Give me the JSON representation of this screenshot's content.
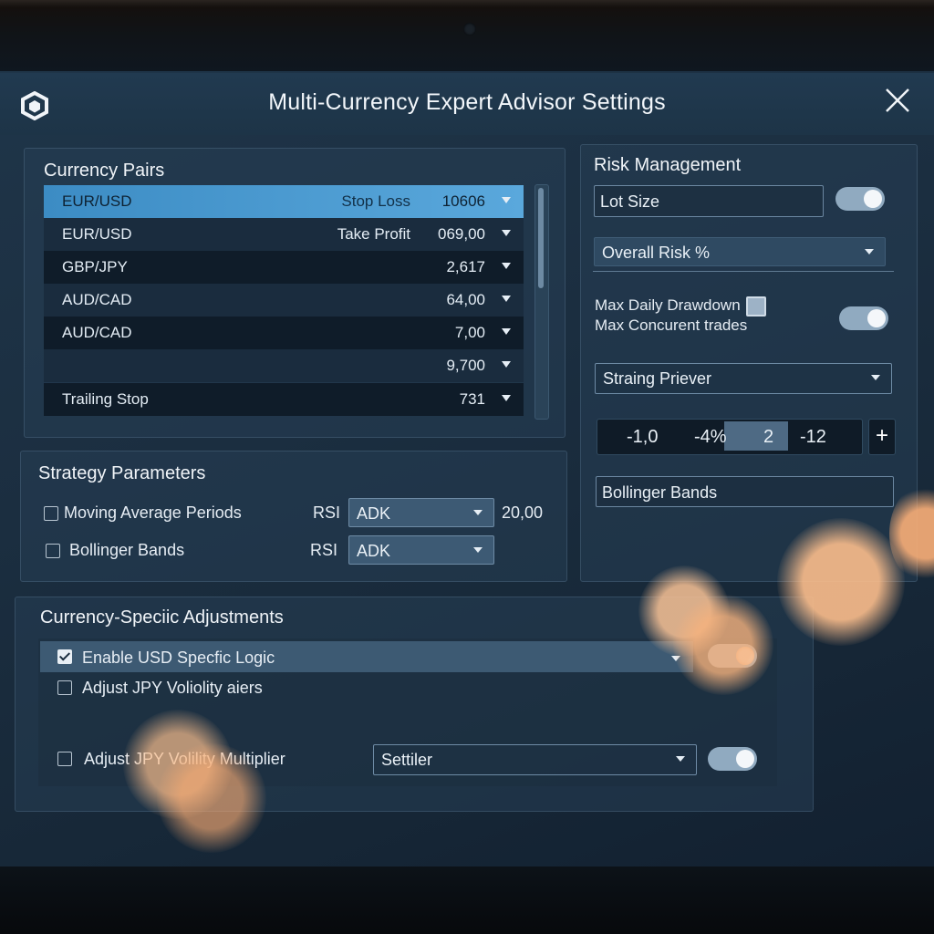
{
  "window": {
    "title": "Multi-Currency Expert Advisor Settings",
    "logo_icon": "cube-logo-icon",
    "close_icon": "close-x-icon"
  },
  "currency_pairs": {
    "title": "Currency Pairs",
    "rows": [
      {
        "name": "EUR/USD",
        "label": "Stop Loss",
        "value": "10606",
        "selected": true
      },
      {
        "name": "EUR/USD",
        "label": "Take Profit",
        "value": "069,00"
      },
      {
        "name": "GBP/JPY",
        "label": "",
        "value": "2,617"
      },
      {
        "name": "AUD/CAD",
        "label": "",
        "value": "64,00"
      },
      {
        "name": "AUD/CAD",
        "label": "",
        "value": "7,00"
      },
      {
        "name": "",
        "label": "",
        "value": "9,700"
      },
      {
        "name": "Trailing Stop",
        "label": "",
        "value": "731"
      }
    ]
  },
  "strategy": {
    "title": "Strategy Parameters",
    "rows": [
      {
        "label": "Moving Average Periods",
        "indicator": "RSI",
        "select": "ADK",
        "value": "20,00"
      },
      {
        "label": "Bollinger Bands",
        "indicator": "RSI",
        "select": "ADK"
      }
    ]
  },
  "risk": {
    "title": "Risk Management",
    "lot_size_placeholder": "Lot Size",
    "overall_risk": "Overall Risk %",
    "max_daily_drawdown": "Max Daily Drawdown",
    "max_concurrent_trades": "Max Concurent trades",
    "strategy_select": "Straing Priever",
    "stepper": [
      "-1,0",
      "-4%",
      "2",
      "-12"
    ],
    "plus_label": "+",
    "bollinger_field": "Bollinger Bands"
  },
  "adjustments": {
    "title": "Currency-Speciic Adjustments",
    "enable_usd": "Enable USD Specfic Logic",
    "adjust_jpy_1": "Adjust JPY Voliolity aiers",
    "adjust_jpy_2": "Adjust JPY Volility Multiplier",
    "multiplier_select": "Settiler"
  },
  "colors": {
    "accent": "#4a9bd4",
    "background": "#1b2e40",
    "bokeh": "#f4b27a"
  }
}
